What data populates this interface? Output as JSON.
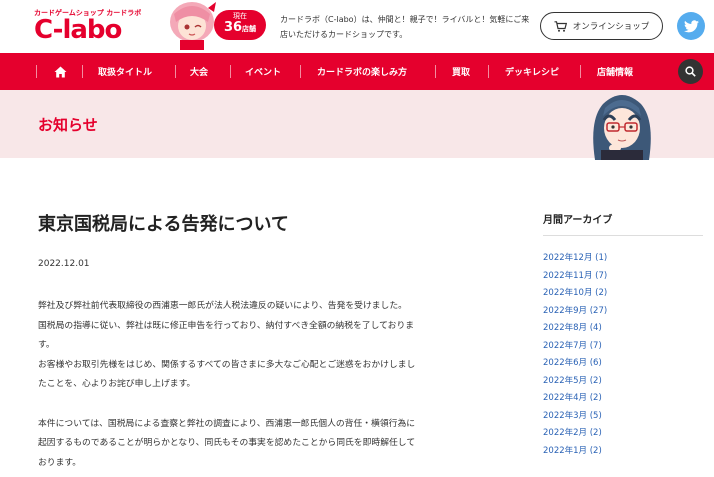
{
  "header": {
    "logo_small": "カードゲームショップ カードラボ",
    "logo_big": "C-labo",
    "store_badge_line1": "現在",
    "store_badge_count": "36",
    "store_badge_unit": "店舗",
    "description": "カードラボ（C-labo）は、仲間と！親子で！ライバルと！気軽にご来店いただけるカードショップです。",
    "shop_button": "オンラインショップ"
  },
  "nav": {
    "items": [
      "取扱タイトル",
      "大会",
      "イベント",
      "カードラボの楽しみ方",
      "買取",
      "デッキレシピ",
      "店舗情報"
    ]
  },
  "band": {
    "title": "お知らせ"
  },
  "article": {
    "title": "東京国税局による告発について",
    "date": "2022.12.01",
    "para1_line1": "弊社及び弊社前代表取締役の西浦恵一郎氏が法人税法違反の疑いにより、告発を受けました。",
    "para1_line2": "国税局の指導に従い、弊社は既に修正申告を行っており、納付すべき全額の納税を了しておりま",
    "para1_line3": "す。",
    "para1_line4": "お客様やお取引先様をはじめ、関係するすべての皆さまに多大なご心配とご迷惑をおかけしまし",
    "para1_line5": "たことを、心よりお詫び申し上げます。",
    "para2_line1": "本件については、国税局による査察と弊社の調査により、西浦恵一郎氏個人の背任・横領行為に",
    "para2_line2": "起因するものであることが明らかとなり、同氏もその事実を認めたことから同氏を即時解任して",
    "para2_line3": "おります。"
  },
  "sidebar": {
    "title": "月間アーカイブ",
    "archives": [
      "2022年12月 (1)",
      "2022年11月 (7)",
      "2022年10月 (2)",
      "2022年9月 (27)",
      "2022年8月 (4)",
      "2022年7月 (7)",
      "2022年6月 (6)",
      "2022年5月 (2)",
      "2022年4月 (2)",
      "2022年3月 (5)",
      "2022年2月 (2)",
      "2022年1月 (2)"
    ]
  },
  "colors": {
    "brand_red": "#e5002d",
    "band_pink": "#f8e7e8",
    "link_blue": "#2a62b5",
    "twitter_blue": "#55acee"
  }
}
